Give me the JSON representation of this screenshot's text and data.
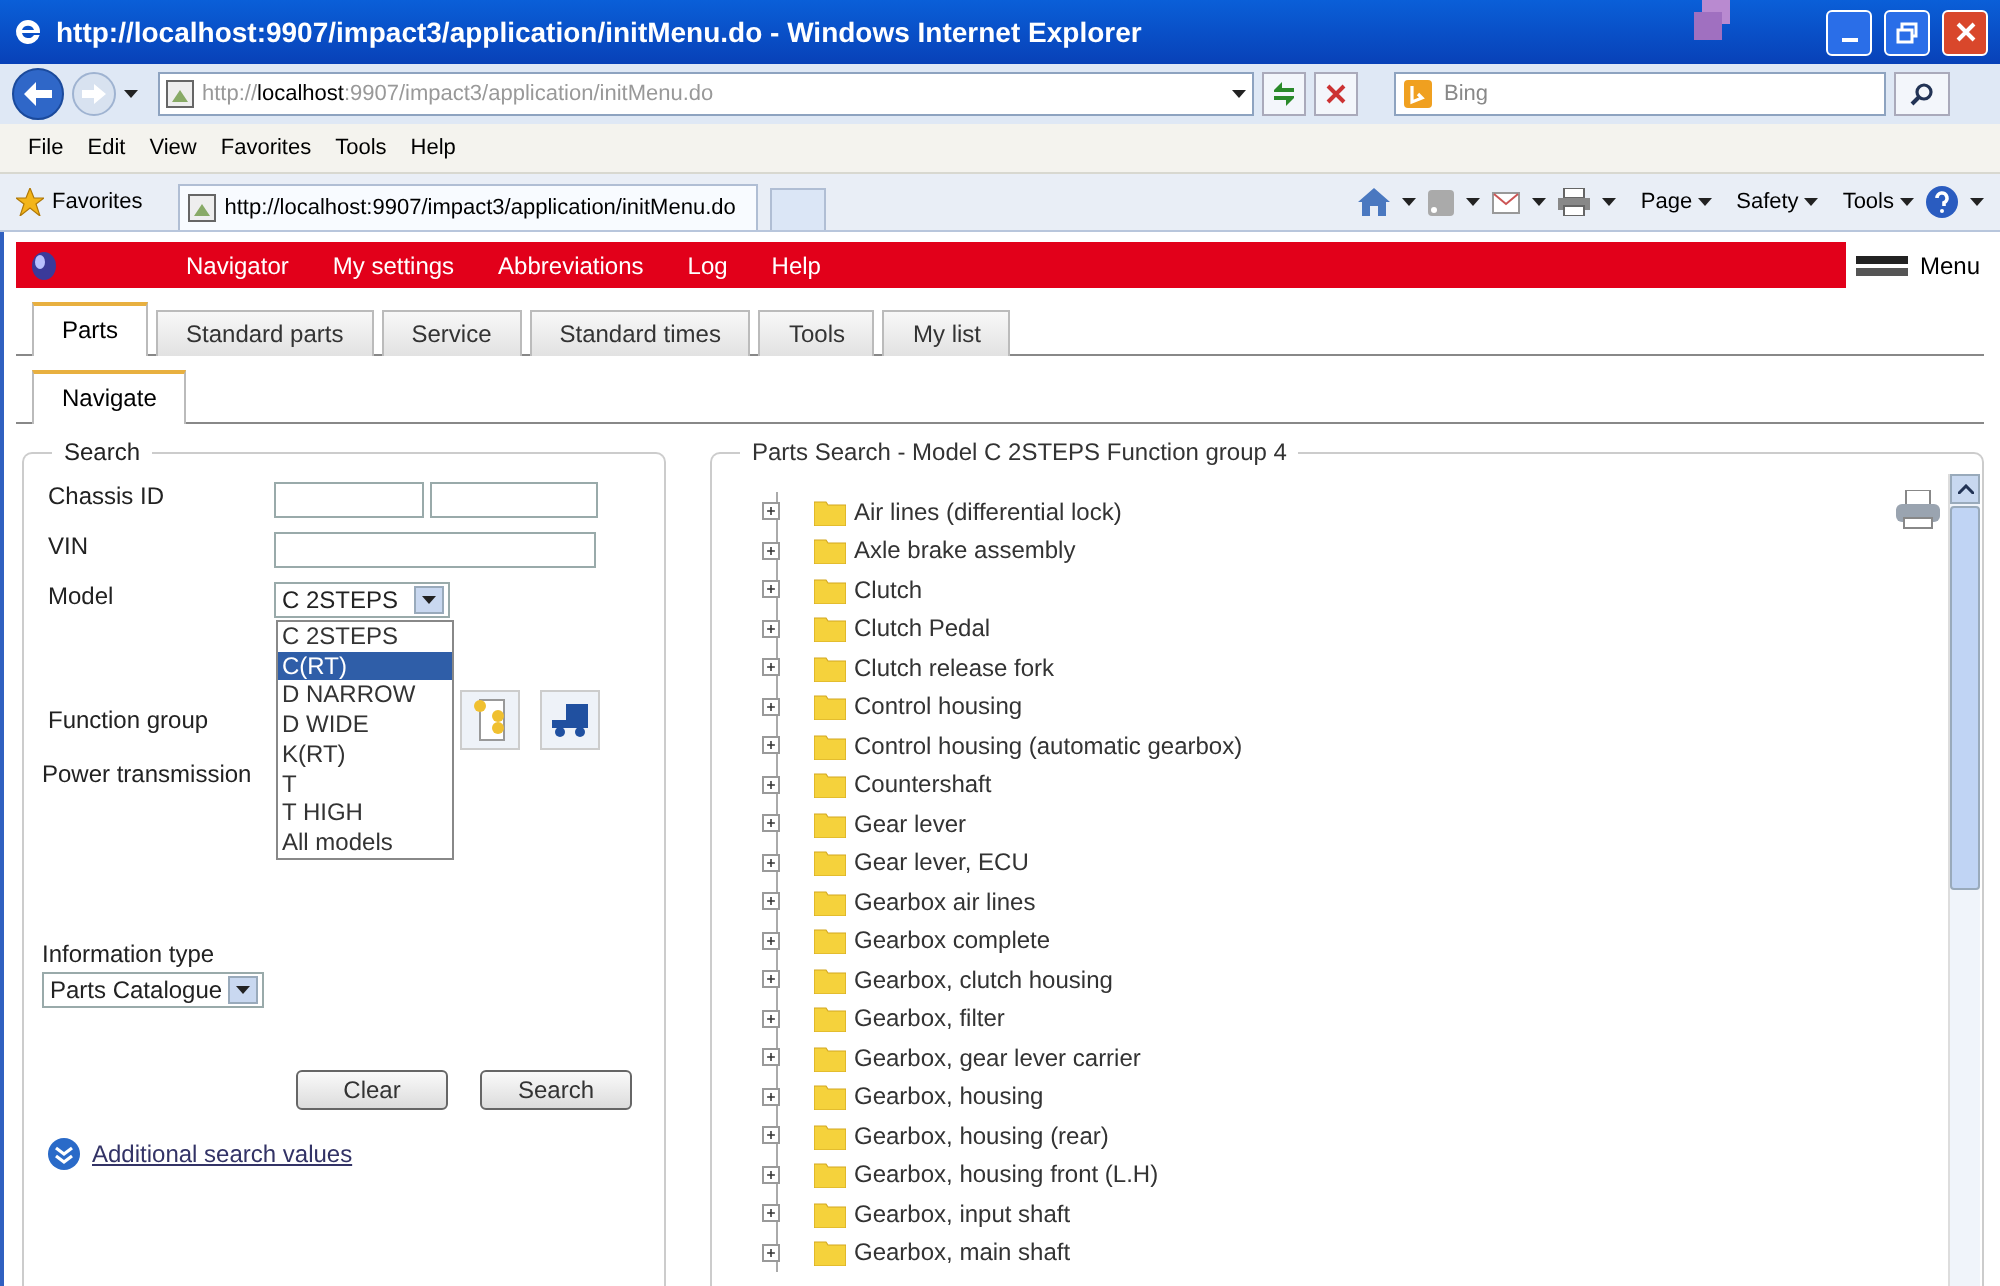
{
  "window": {
    "title": "http://localhost:9907/impact3/application/initMenu.do - Windows Internet Explorer"
  },
  "address_bar": {
    "url": "http://**localhost**:9907/impact3/application/initMenu.do"
  },
  "search_box": {
    "placeholder": "Bing"
  },
  "menu_bar": [
    "File",
    "Edit",
    "View",
    "Favorites",
    "Tools",
    "Help"
  ],
  "favorites_bar": {
    "favorites": "Favorites",
    "tab_title": "http://localhost:9907/impact3/application/initMenu.do",
    "commands": [
      "Page",
      "Safety",
      "Tools"
    ]
  },
  "app_menu": {
    "items": [
      "Navigator",
      "My settings",
      "Abbreviations",
      "Log",
      "Help"
    ],
    "menu": "Menu"
  },
  "tabs": [
    {
      "label": "Parts",
      "selected": true
    },
    {
      "label": "Standard parts",
      "selected": false
    },
    {
      "label": "Service",
      "selected": false
    },
    {
      "label": "Standard times",
      "selected": false
    },
    {
      "label": "Tools",
      "selected": false
    },
    {
      "label": "My list",
      "selected": false
    }
  ],
  "subtabs": [
    {
      "label": "Navigate",
      "selected": true
    }
  ],
  "search": {
    "legend": "Search",
    "chassis_id_label": "Chassis ID",
    "vin_label": "VIN",
    "model_label": "Model",
    "model_value": "C 2STEPS",
    "model_options": [
      {
        "label": "C 2STEPS",
        "selected": false
      },
      {
        "label": "C(RT)",
        "selected": true
      },
      {
        "label": "D NARROW",
        "selected": false
      },
      {
        "label": "D WIDE",
        "selected": false
      },
      {
        "label": "K(RT)",
        "selected": false
      },
      {
        "label": "T",
        "selected": false
      },
      {
        "label": "T HIGH",
        "selected": false
      },
      {
        "label": "All models",
        "selected": false
      }
    ],
    "function_group_label": "Function group",
    "power_transmission_label": "Power transmission",
    "information_type_label": "Information type",
    "information_type_value": "Parts Catalogue",
    "buttons": [
      "Clear",
      "Search"
    ],
    "additional_link": "Additional search values"
  },
  "parts_tree": {
    "title": "Parts Search - Model C 2STEPS Function group 4",
    "items": [
      {
        "label": "Air lines (differential lock)",
        "expanded": false
      },
      {
        "label": "Axle brake assembly",
        "expanded": false
      },
      {
        "label": "Clutch",
        "expanded": false
      },
      {
        "label": "Clutch Pedal",
        "expanded": false
      },
      {
        "label": "Clutch release fork",
        "expanded": false
      },
      {
        "label": "Control housing",
        "expanded": false
      },
      {
        "label": "Control housing (automatic gearbox)",
        "expanded": false
      },
      {
        "label": "Countershaft",
        "expanded": false
      },
      {
        "label": "Gear lever",
        "expanded": false
      },
      {
        "label": "Gear lever, ECU",
        "expanded": false
      },
      {
        "label": "Gearbox air lines",
        "expanded": false
      },
      {
        "label": "Gearbox complete",
        "expanded": false
      },
      {
        "label": "Gearbox, clutch housing",
        "expanded": false
      },
      {
        "label": "Gearbox, filter",
        "expanded": false
      },
      {
        "label": "Gearbox, gear lever carrier",
        "expanded": false
      },
      {
        "label": "Gearbox, housing",
        "expanded": false
      },
      {
        "label": "Gearbox, housing (rear)",
        "expanded": false
      },
      {
        "label": "Gearbox, housing front (L.H)",
        "expanded": false
      },
      {
        "label": "Gearbox, input shaft",
        "expanded": false
      },
      {
        "label": "Gearbox, main shaft",
        "expanded": false
      }
    ]
  }
}
